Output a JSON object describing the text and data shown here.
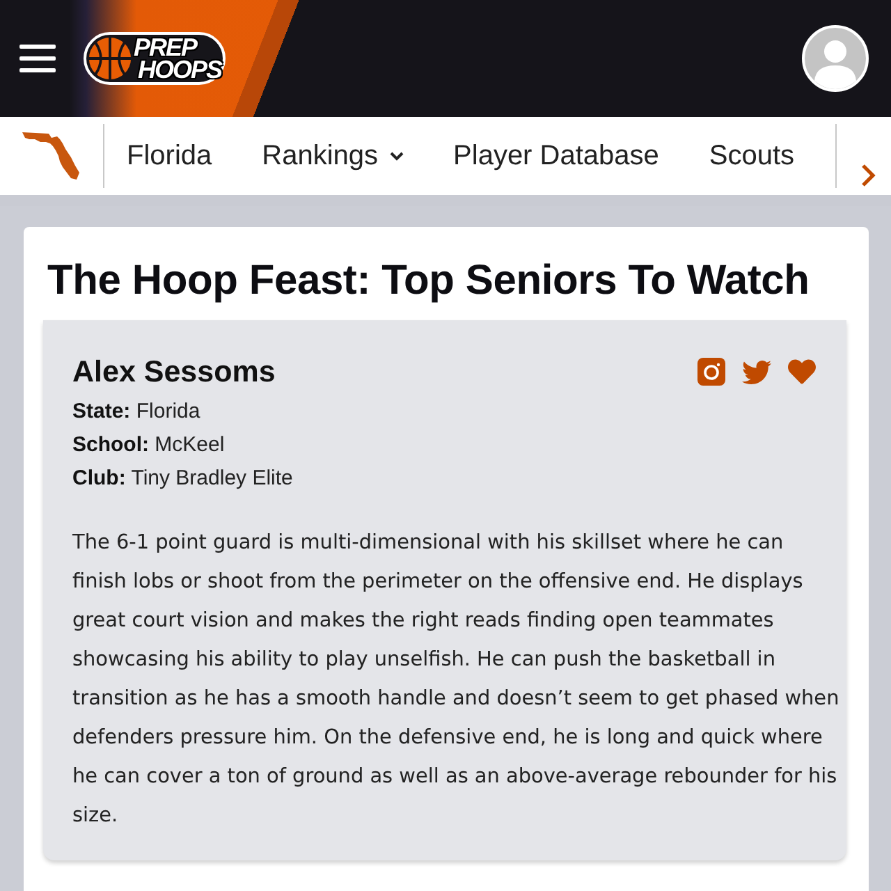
{
  "header": {
    "logo": [
      "PREP",
      "HOOPS"
    ]
  },
  "nav": {
    "items": [
      {
        "label": "Florida",
        "kind": "link"
      },
      {
        "label": "Rankings",
        "kind": "dropdown"
      },
      {
        "label": "Player Database",
        "kind": "link"
      },
      {
        "label": "Scouts",
        "kind": "link"
      }
    ]
  },
  "article": {
    "title": "The Hoop Feast: Top Seniors To Watch",
    "player": {
      "name": "Alex Sessoms",
      "details": [
        "**State:** Florida",
        "**School:** McKeel",
        "**Club:** Tiny Bradley Elite"
      ],
      "bio": "The 6-1 point guard is multi-dimensional with his skillset where he can finish lobs or shoot from the perimeter on the offensive end. He displays great court vision and makes the right reads finding open teammates showcasing his ability to play unselfish. He can push the basketball in transition as he has a smooth handle and doesn’t seem to get phased when defenders pressure him. On the defensive end, he is long and quick where he can cover a ton of ground as well as an above-average rebounder for his size."
    }
  }
}
